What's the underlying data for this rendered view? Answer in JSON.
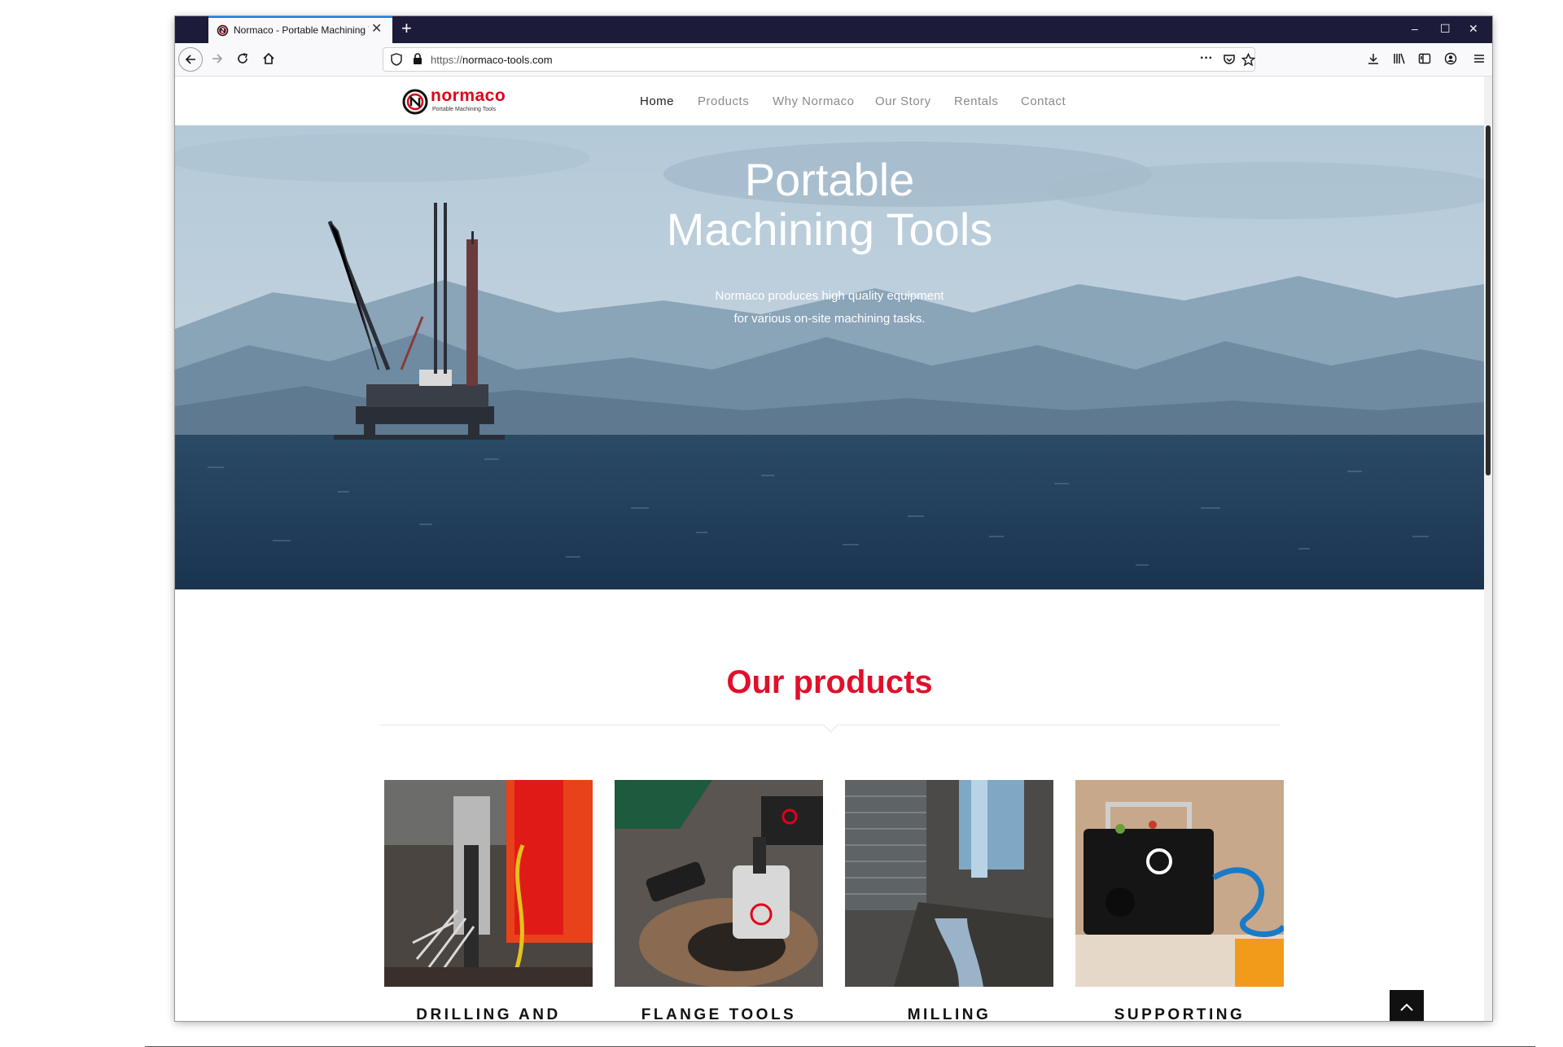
{
  "browser": {
    "tab_title": "Normaco - Portable Machining Tools",
    "new_tab_symbol": "+",
    "url_protocol": "https://",
    "url_host": "normaco-tools.com",
    "window_controls": [
      "–",
      "☐",
      "✕"
    ]
  },
  "site": {
    "logo_word": "normaco",
    "logo_tagline": "Portable Machining Tools",
    "nav": [
      {
        "label": "Home",
        "active": true
      },
      {
        "label": "Products",
        "active": false
      },
      {
        "label": "Why Normaco",
        "active": false
      },
      {
        "label": "Our Story",
        "active": false
      },
      {
        "label": "Rentals",
        "active": false
      },
      {
        "label": "Contact",
        "active": false
      }
    ]
  },
  "hero": {
    "title_line1": "Portable",
    "title_line2": "Machining Tools",
    "subtitle_line1": "Normaco produces high quality equipment",
    "subtitle_line2": "for various on-site machining tasks."
  },
  "products": {
    "heading": "Our products",
    "items": [
      {
        "label": "DRILLING AND BORING"
      },
      {
        "label": "FLANGE TOOLS"
      },
      {
        "label": "MILLING"
      },
      {
        "label": "SUPPORTING EQUIPMENT"
      }
    ]
  },
  "colors": {
    "brand_red": "#e2001a",
    "tab_strip": "#1c1b3a",
    "accent_blue": "#0a84ff"
  },
  "icons": [
    "normaco-favicon-icon",
    "close-icon",
    "back-icon",
    "forward-icon",
    "reload-icon",
    "home-icon",
    "shield-icon",
    "lock-icon",
    "more-icon",
    "pocket-icon",
    "star-icon",
    "download-icon",
    "library-icon",
    "sidebar-icon",
    "account-icon",
    "menu-icon",
    "arrow-up-icon"
  ]
}
